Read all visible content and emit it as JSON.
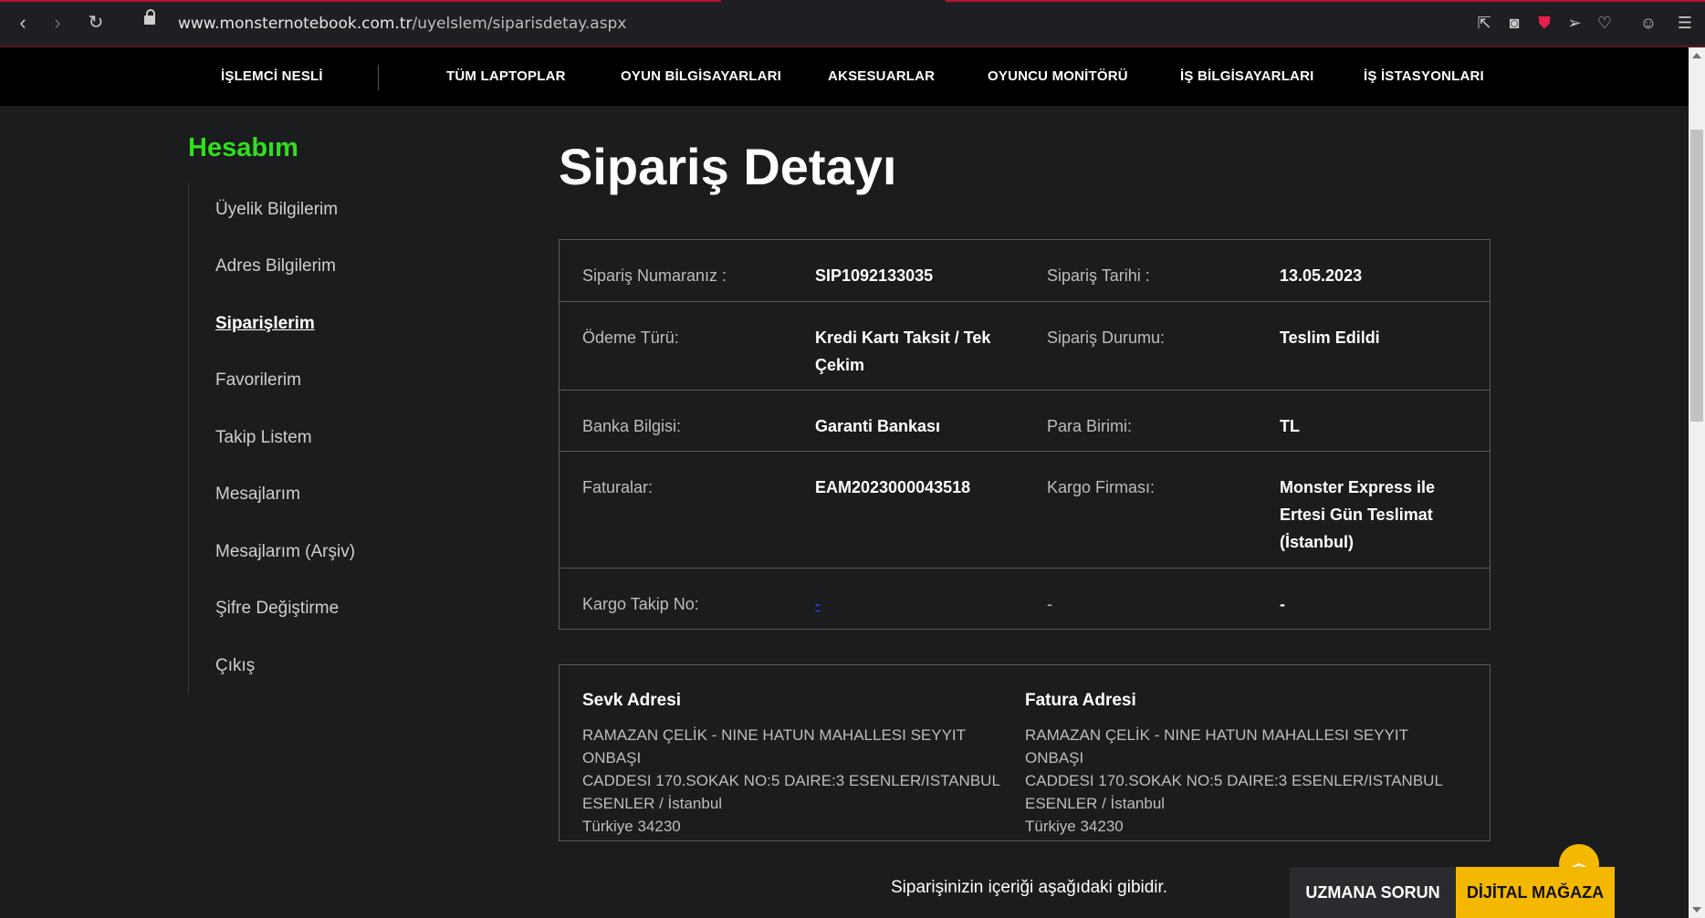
{
  "browser": {
    "url_domain": "www.monsternotebook.com.tr",
    "url_path": "/uyelslem/siparisdetay.aspx"
  },
  "nav": {
    "items": [
      "İŞLEMCİ NESLİ",
      "TÜM LAPTOPLAR",
      "OYUN BİLGİSAYARLARI",
      "AKSESUARLAR",
      "OYUNCU MONİTÖRÜ",
      "İŞ BİLGİSAYARLARI",
      "İŞ İSTASYONLARI"
    ]
  },
  "sidebar": {
    "title": "Hesabım",
    "items": [
      "Üyelik Bilgilerim",
      "Adres Bilgilerim",
      "Siparişlerim",
      "Favorilerim",
      "Takip Listem",
      "Mesajlarım",
      "Mesajlarım (Arşiv)",
      "Şifre Değiştirme",
      "Çıkış"
    ],
    "active_index": 2
  },
  "main": {
    "title": "Sipariş Detayı",
    "rows": [
      {
        "l1": "Sipariş Numaranız :",
        "v1": "SIP1092133035",
        "l2": "Sipariş Tarihi :",
        "v2": "13.05.2023"
      },
      {
        "l1": "Ödeme Türü:",
        "v1": "Kredi Kartı Taksit / Tek Çekim",
        "l2": "Sipariş Durumu:",
        "v2": "Teslim Edildi"
      },
      {
        "l1": "Banka Bilgisi:",
        "v1": "Garanti Bankası",
        "l2": "Para Birimi:",
        "v2": "TL"
      },
      {
        "l1": "Faturalar:",
        "v1": "EAM2023000043518",
        "l2": "Kargo Firması:",
        "v2": "Monster Express ile Ertesi Gün Teslimat (İstanbul)"
      },
      {
        "l1": "Kargo Takip No:",
        "v1": "-",
        "l2": "-",
        "v2": "-"
      }
    ],
    "shipping": {
      "title": "Sevk Adresi",
      "line1": "RAMAZAN ÇELİK - NINE HATUN MAHALLESI SEYYIT ONBAŞI",
      "line2": "CADDESI 170.SOKAK NO:5 DAIRE:3 ESENLER/ISTANBUL",
      "line3": "ESENLER / İstanbul",
      "line4": "Türkiye 34230"
    },
    "billing": {
      "title": "Fatura Adresi",
      "line1": "RAMAZAN ÇELİK - NINE HATUN MAHALLESI SEYYIT ONBAŞI",
      "line2": "CADDESI 170.SOKAK NO:5 DAIRE:3 ESENLER/ISTANBUL",
      "line3": "ESENLER / İstanbul",
      "line4": "Türkiye 34230"
    },
    "note": "Siparişinizin içeriği aşağıdaki gibidir."
  },
  "floating": {
    "ask_expert": "UZMANA SORUN",
    "digital_store": "DİJİTAL MAĞAZA"
  },
  "colors": {
    "accent_green": "#2fe01c",
    "accent_yellow": "#f5b800",
    "background": "#1b1c1e",
    "browser_accent": "#b3132c"
  }
}
